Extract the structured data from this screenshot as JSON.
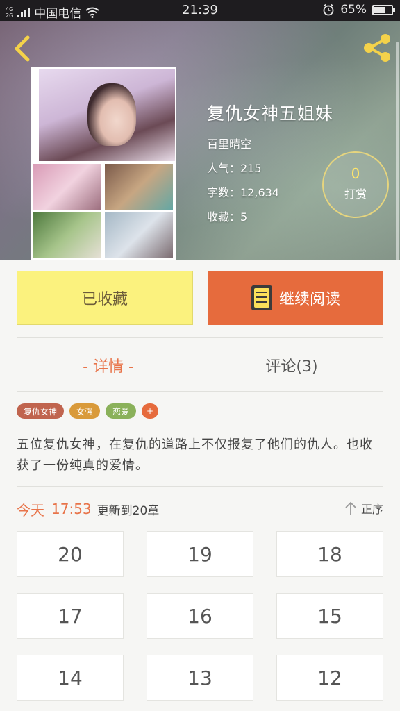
{
  "status_bar": {
    "network_top": "4G",
    "network_bottom": "2G",
    "carrier": "中国电信",
    "time": "21:39",
    "battery": "65%",
    "battery_level": 0.65
  },
  "book": {
    "title": "复仇女神五姐妹",
    "author": "百里晴空",
    "popularity": "人气：215",
    "word_count": "字数：12,634",
    "favorites": "收藏：5",
    "tip_count": "0",
    "tip_label": "打赏"
  },
  "actions": {
    "favorite_label": "已收藏",
    "continue_label": "继续阅读"
  },
  "tabs": {
    "detail": "- 详情 -",
    "comments": "评论(3)"
  },
  "tags": [
    {
      "label": "复仇女神",
      "color": "#c0644e"
    },
    {
      "label": "女强",
      "color": "#d99a3a"
    },
    {
      "label": "恋爱",
      "color": "#8ab15a"
    }
  ],
  "tag_add": "+",
  "summary": "五位复仇女神，在复仇的道路上不仅报复了他们的仇人。也收获了一份纯真的爱情。",
  "update": {
    "day": "今天",
    "time": "17:53",
    "text": "更新到20章",
    "sort_label": "正序"
  },
  "chapters": [
    "20",
    "19",
    "18",
    "17",
    "16",
    "15",
    "14",
    "13",
    "12"
  ],
  "colors": {
    "accent_orange": "#e66b3d",
    "favorite_yellow": "#fbf27e",
    "tip_yellow": "#ffe66a"
  }
}
